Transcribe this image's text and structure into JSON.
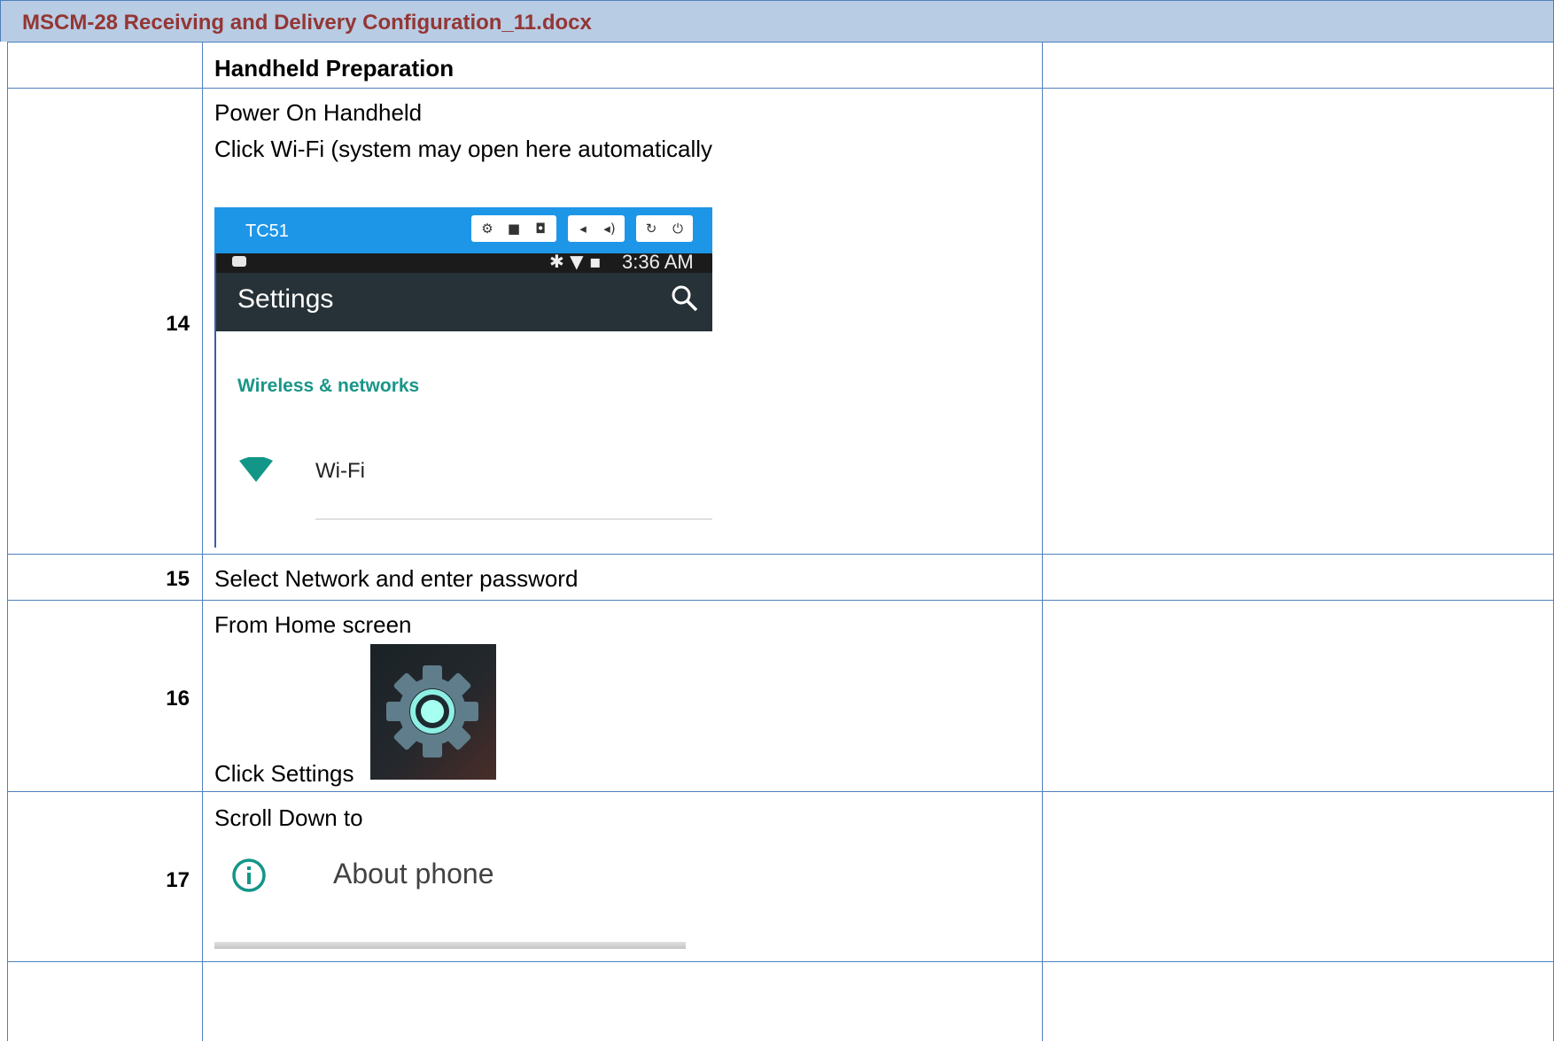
{
  "document": {
    "title": "MSCM-28 Receiving and Delivery Configuration_11.docx"
  },
  "rows": [
    {
      "step": "",
      "text": "Handheld Preparation"
    },
    {
      "step": "14",
      "line1": "Power On Handheld",
      "line2": "Click Wi-Fi (system may open here automatically"
    },
    {
      "step": "15",
      "text": "Select Network and enter password"
    },
    {
      "step": "16",
      "line1": "From Home screen",
      "line2": "Click Settings"
    },
    {
      "step": "17",
      "text": "Scroll Down to"
    }
  ],
  "phone_screenshot": {
    "model": "TC51",
    "time": "3:36 AM",
    "title": "Settings",
    "section": "Wireless & networks",
    "item": "Wi-Fi",
    "icons": [
      "settings-icon",
      "video-icon",
      "camera-icon",
      "volume-down-icon",
      "volume-up-icon",
      "rotate-icon",
      "power-icon",
      "search-icon",
      "wifi-icon"
    ]
  },
  "about_phone": {
    "label": "About phone",
    "icon": "info-icon"
  },
  "colors": {
    "header_bg": "#b8cce4",
    "header_text": "#943634",
    "border": "#4f81bd",
    "accent": "#199588"
  }
}
